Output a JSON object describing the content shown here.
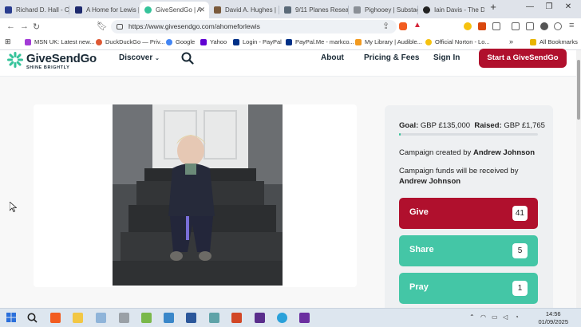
{
  "browser": {
    "tabs": [
      {
        "title": "Richard D. Hall - Co",
        "color": "#2a3d8f"
      },
      {
        "title": "A Home for Lewis |",
        "color": "#1e2a6e"
      },
      {
        "title": "GiveSendGo | A",
        "color": "#35c39a",
        "active": true
      },
      {
        "title": "David A. Hughes | S",
        "color": "#7a5a3c"
      },
      {
        "title": "9/11 Planes Resea",
        "color": "#5b6a78"
      },
      {
        "title": "Pighooey | Substac",
        "color": "#8a8f96"
      },
      {
        "title": "Iain Davis - The Dis",
        "color": "#222222"
      }
    ],
    "new_tab_label": "+",
    "url": "https://www.givesendgo.com/ahomeforlewis",
    "bookmarks": [
      {
        "label": "MSN UK: Latest new...",
        "color": "#a23bd6"
      },
      {
        "label": "DuckDuckGo — Priv...",
        "color": "#de5833"
      },
      {
        "label": "Google",
        "color": "#4285f4"
      },
      {
        "label": "Yahoo",
        "color": "#6001d2"
      },
      {
        "label": "Login - PayPal",
        "color": "#003087"
      },
      {
        "label": "PayPal.Me - markco...",
        "color": "#003087"
      },
      {
        "label": "My Library | Audible...",
        "color": "#f29a1f"
      },
      {
        "label": "Official Norton - Lo...",
        "color": "#f6c20f"
      }
    ],
    "all_bookmarks_label": "All Bookmarks"
  },
  "site": {
    "logo_name": "GiveSendGo",
    "logo_tagline": "SHINE BRIGHTLY",
    "nav": {
      "discover": "Discover",
      "about": "About",
      "pricing": "Pricing & Fees",
      "signin": "Sign In",
      "start": "Start a GiveSendGo"
    },
    "brand_color": "#b0102d",
    "accent_color": "#35c39a"
  },
  "campaign": {
    "goal_label": "Goal:",
    "goal_value": "GBP £135,000",
    "raised_label": "Raised:",
    "raised_value": "GBP £1,765",
    "progress_fraction": 0.013,
    "created_by_label": "Campaign created by",
    "created_by": "Andrew Johnson",
    "received_by_label": "Campaign funds will be received by",
    "received_by": "Andrew Johnson",
    "actions": [
      {
        "label": "Give",
        "count": "41",
        "color": "#b0102d"
      },
      {
        "label": "Share",
        "count": "5",
        "color": "#44c6a6"
      },
      {
        "label": "Pray",
        "count": "1",
        "color": "#44c6a6"
      }
    ]
  },
  "taskbar": {
    "time": "14:56",
    "date": "01/09/2025"
  }
}
